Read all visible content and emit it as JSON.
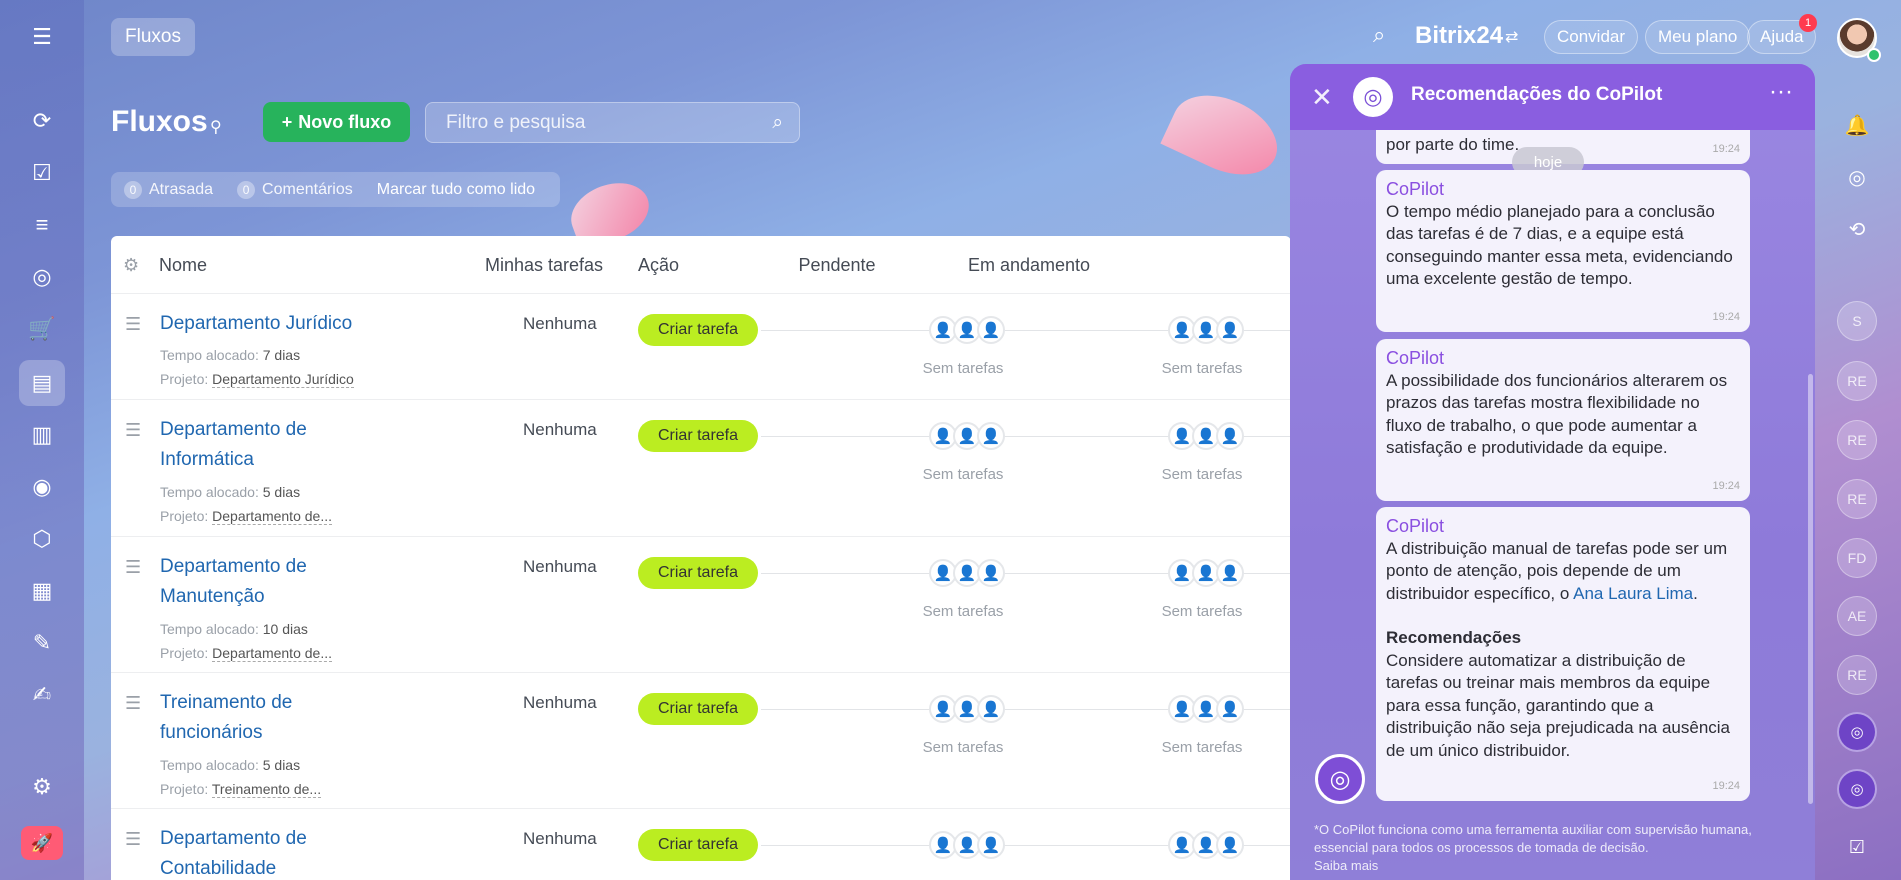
{
  "topbar": {
    "section_chip": "Fluxos",
    "brand": "Bitrix24",
    "invite_label": "Convidar",
    "plan_label": "Meu plano",
    "help_label": "Ajuda",
    "help_badge": "1"
  },
  "page": {
    "title": "Fluxos",
    "new_flow_label": "Novo fluxo",
    "search_placeholder": "Filtro e pesquisa",
    "counters": [
      {
        "count": "0",
        "label": "Atrasada"
      },
      {
        "count": "0",
        "label": "Comentários"
      }
    ],
    "mark_all_read": "Marcar tudo como lido"
  },
  "table": {
    "headers": {
      "name": "Nome",
      "mine": "Minhas tarefas",
      "action": "Ação",
      "pending": "Pendente",
      "in_progress": "Em andamento"
    },
    "rows": [
      {
        "name": "Departamento Jurídico",
        "time_label": "Tempo alocado:",
        "time": "7 dias",
        "project_label": "Projeto:",
        "project": "Departamento Jurídico",
        "mine": "Nenhuma",
        "action": "Criar tarefa",
        "pending": "Sem tarefas",
        "in_progress": "Sem tarefas"
      },
      {
        "name": "Departamento de Informática",
        "time_label": "Tempo alocado:",
        "time": "5 dias",
        "project_label": "Projeto:",
        "project": "Departamento de...",
        "mine": "Nenhuma",
        "action": "Criar tarefa",
        "pending": "Sem tarefas",
        "in_progress": "Sem tarefas"
      },
      {
        "name": "Departamento de Manutenção",
        "time_label": "Tempo alocado:",
        "time": "10 dias",
        "project_label": "Projeto:",
        "project": "Departamento de...",
        "mine": "Nenhuma",
        "action": "Criar tarefa",
        "pending": "Sem tarefas",
        "in_progress": "Sem tarefas"
      },
      {
        "name": "Treinamento de funcionários",
        "time_label": "Tempo alocado:",
        "time": "5 dias",
        "project_label": "Projeto:",
        "project": "Treinamento de...",
        "mine": "Nenhuma",
        "action": "Criar tarefa",
        "pending": "Sem tarefas",
        "in_progress": "Sem tarefas"
      },
      {
        "name": "Departamento de Contabilidade",
        "mine": "Nenhuma",
        "action": "Criar tarefa"
      }
    ]
  },
  "copilot": {
    "title": "Recomendações do CoPilot",
    "partial_text": "por parte do time.",
    "partial_time": "19:24",
    "date_separator": "hoje",
    "messages": [
      {
        "author": "CoPilot",
        "text": "O tempo médio planejado para a conclusão das tarefas é de 7 dias, e a equipe está conseguindo manter essa meta, evidenciando uma excelente gestão de tempo.",
        "time": "19:24"
      },
      {
        "author": "CoPilot",
        "text": "A possibilidade dos funcionários alterarem os prazos das tarefas mostra flexibilidade no fluxo de trabalho, o que pode aumentar a satisfação e produtividade da equipe.",
        "time": "19:24"
      },
      {
        "author": "CoPilot",
        "text_before_link": "A distribuição manual de tarefas pode ser um ponto de atenção, pois depende de um distribuidor específico, o ",
        "link": "Ana Laura Lima",
        "text_after_link": ".",
        "rec_title": "Recomendações",
        "rec_text": "Considere automatizar a distribuição de tarefas ou treinar mais membros da equipe para essa função, garantindo que a distribuição não seja prejudicada na ausência de um único distribuidor.",
        "time": "19:24"
      }
    ],
    "disclaimer": "*O CoPilot funciona como uma ferramenta auxiliar com supervisão humana, essencial para todos os processos de tomada de decisão.",
    "learn_more": "Saiba mais"
  },
  "right_rail": {
    "initials": [
      "S",
      "RE",
      "RE",
      "RE",
      "FD",
      "AE",
      "RE"
    ]
  },
  "colors": {
    "accent_green": "#27b35c",
    "create_button": "#bbed21",
    "copilot_header": "#8a5ee0",
    "link": "#2067b0"
  }
}
